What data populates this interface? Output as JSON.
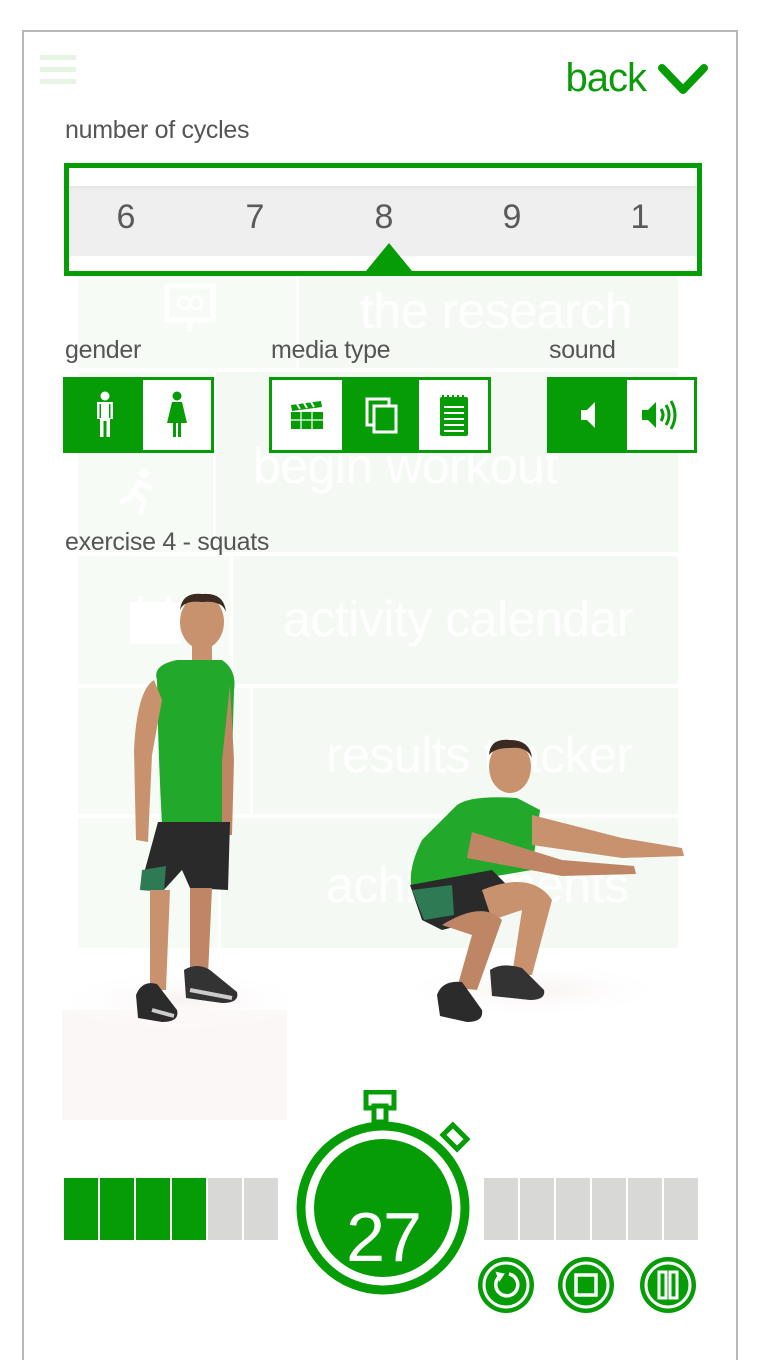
{
  "colors": {
    "accent": "#069c06",
    "segment_inactive": "#d8d9d7",
    "label_text": "#555555"
  },
  "header": {
    "menu_icon": "hamburger-icon",
    "back_label": "back",
    "back_icon": "chevron-down-icon"
  },
  "cycles": {
    "label": "number of cycles",
    "options": [
      "6",
      "7",
      "8",
      "9",
      "1"
    ],
    "selected": "8"
  },
  "settings": {
    "gender": {
      "label": "gender",
      "options": [
        {
          "icon": "male-icon",
          "name": "male",
          "selected": true
        },
        {
          "icon": "female-icon",
          "name": "female",
          "selected": false
        }
      ]
    },
    "media_type": {
      "label": "media type",
      "options": [
        {
          "icon": "video-clapper-icon",
          "name": "video",
          "selected": false
        },
        {
          "icon": "photos-icon",
          "name": "images",
          "selected": true
        },
        {
          "icon": "notepad-icon",
          "name": "text",
          "selected": false
        }
      ]
    },
    "sound": {
      "label": "sound",
      "options": [
        {
          "icon": "speaker-mute-icon",
          "name": "mute",
          "selected": true
        },
        {
          "icon": "speaker-loud-icon",
          "name": "loud",
          "selected": false
        }
      ]
    }
  },
  "exercise": {
    "title": "exercise 4 - squats",
    "image": "man-squat-demonstration"
  },
  "ghost_menu": {
    "items": [
      {
        "label": "the research",
        "icon": "presentation-icon"
      },
      {
        "label": "begin workout",
        "icon": "runner-icon"
      },
      {
        "label": "activity calendar",
        "icon": "calendar-icon"
      },
      {
        "label": "results tracker",
        "icon": "chart-icon"
      },
      {
        "label": "achievements",
        "icon": "trophy-icon"
      }
    ]
  },
  "workout_progress": {
    "total_exercises": 12,
    "completed_exercises": 4,
    "left_segments": 6,
    "right_segments": 6
  },
  "timer": {
    "seconds_remaining": "27",
    "icon": "stopwatch-icon"
  },
  "controls": [
    {
      "name": "restart",
      "icon": "restart-icon"
    },
    {
      "name": "stop",
      "icon": "stop-icon"
    },
    {
      "name": "pause",
      "icon": "pause-icon"
    }
  ]
}
